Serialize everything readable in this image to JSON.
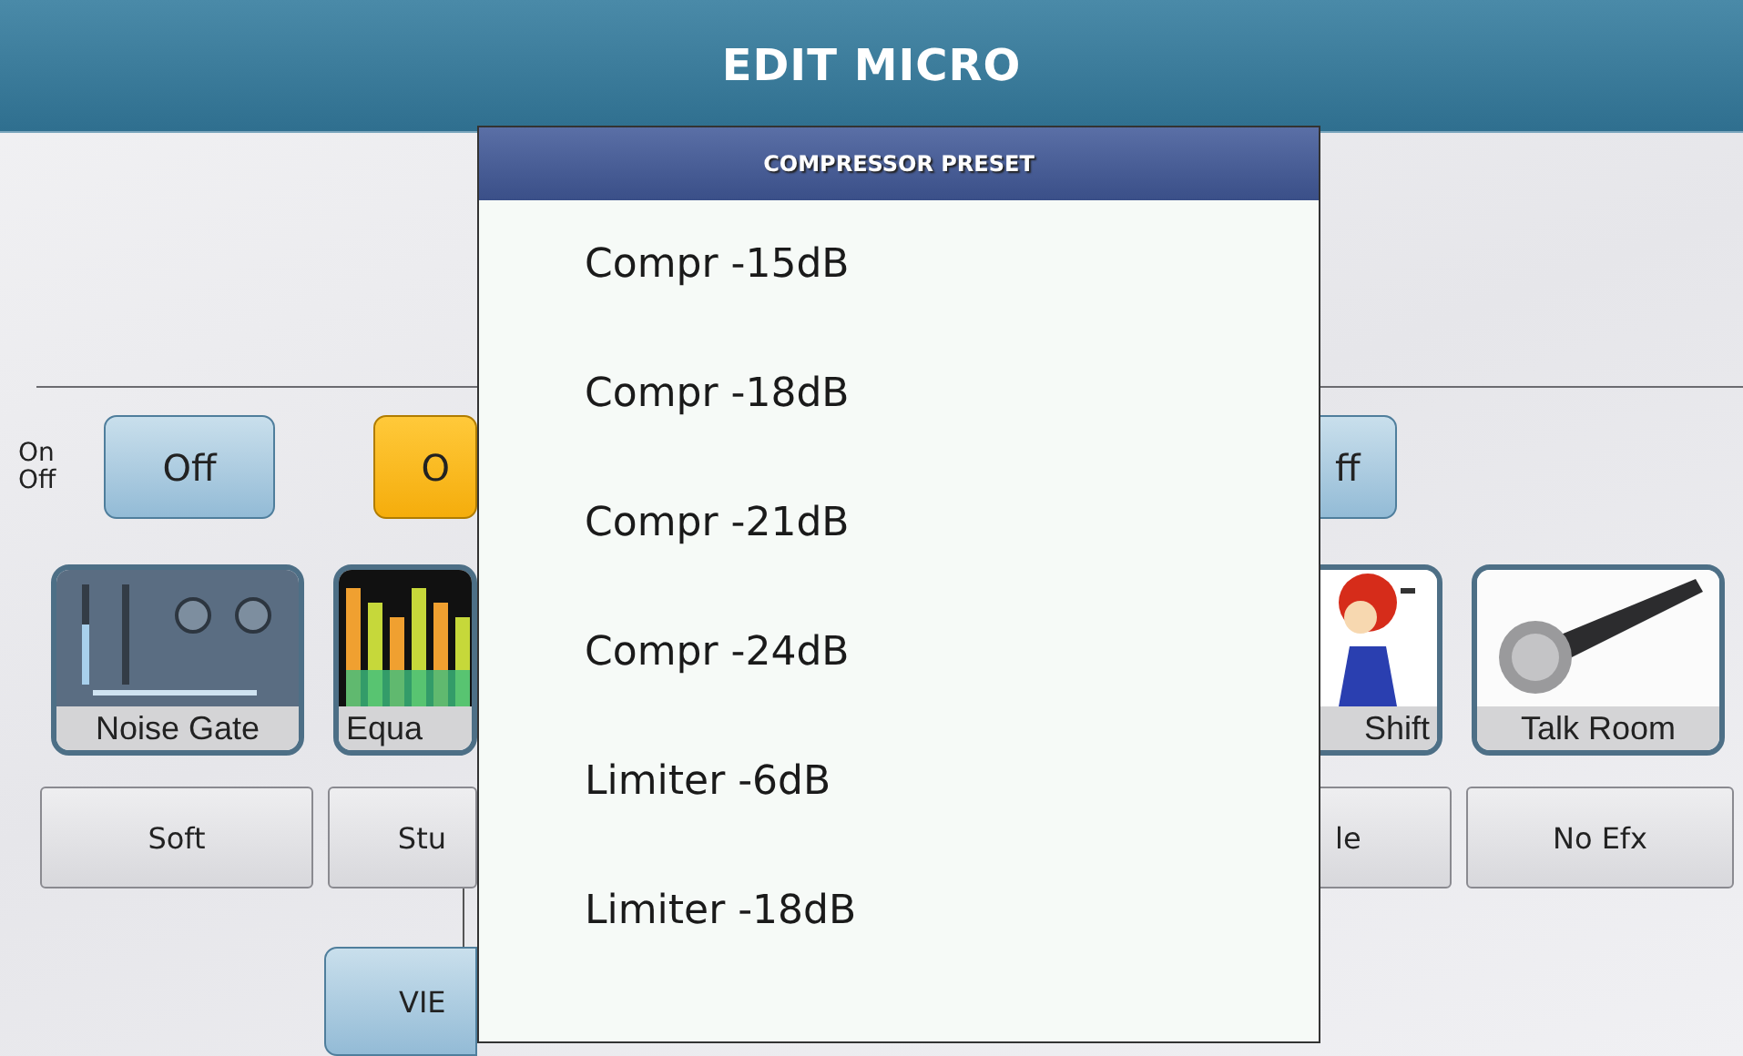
{
  "header": {
    "title": "EDIT MICRO"
  },
  "switch_label": [
    "On",
    "Off"
  ],
  "toggles": [
    {
      "label": "Off",
      "on": false
    },
    {
      "label": "O",
      "on": true
    },
    {
      "label": "ff",
      "on": false
    }
  ],
  "effects": [
    {
      "label": "Noise Gate",
      "kind": "mixer"
    },
    {
      "label": "Equa",
      "kind": "equalizer"
    },
    {
      "label": "Shift",
      "kind": "cartoon"
    },
    {
      "label": "Talk Room",
      "kind": "microphone"
    }
  ],
  "presets": [
    "Soft",
    "Stu",
    "le",
    "No Efx"
  ],
  "view_button": "VIE",
  "popup": {
    "title": "COMPRESSOR PRESET",
    "items": [
      "Compr -15dB",
      "Compr -18dB",
      "Compr -21dB",
      "Compr -24dB",
      "Limiter -6dB",
      "Limiter -18dB"
    ]
  }
}
